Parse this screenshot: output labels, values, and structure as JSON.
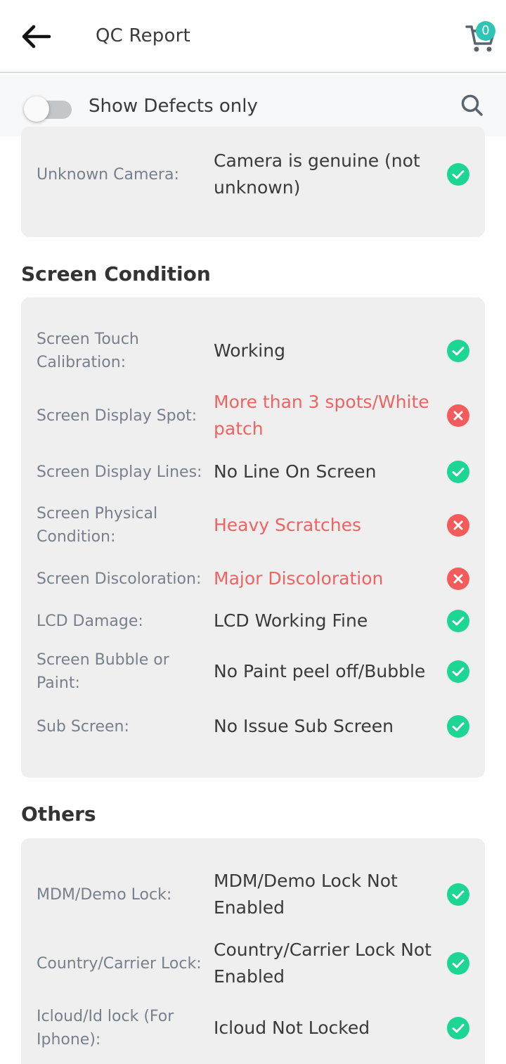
{
  "header": {
    "title": "QC Report",
    "cart_count": "0"
  },
  "filter": {
    "label": "Show Defects only",
    "toggle_on": false
  },
  "colors": {
    "ok": "#1ed694",
    "defect": "#f45c5c",
    "defect_text": "#ef6461",
    "badge": "#2ec4b6"
  },
  "camera": {
    "rows": [
      {
        "label": "Unknown Camera:",
        "value": "Camera is genuine (not unknown)",
        "status": "ok"
      }
    ]
  },
  "screen": {
    "title": "Screen Condition",
    "rows": [
      {
        "label": "Screen Touch Calibration:",
        "value": "Working",
        "status": "ok"
      },
      {
        "label": "Screen Display Spot:",
        "value": "More than 3 spots/White patch",
        "status": "defect"
      },
      {
        "label": "Screen Display Lines:",
        "value": "No Line On Screen",
        "status": "ok"
      },
      {
        "label": "Screen Physical Condition:",
        "value": "Heavy Scratches",
        "status": "defect"
      },
      {
        "label": "Screen Discoloration:",
        "value": "Major Discoloration",
        "status": "defect"
      },
      {
        "label": "LCD Damage:",
        "value": "LCD Working Fine",
        "status": "ok"
      },
      {
        "label": "Screen Bubble or Paint:",
        "value": "No Paint peel off/Bubble",
        "status": "ok"
      },
      {
        "label": "Sub Screen:",
        "value": "No Issue Sub Screen",
        "status": "ok"
      }
    ]
  },
  "others": {
    "title": "Others",
    "rows": [
      {
        "label": "MDM/Demo Lock:",
        "value": "MDM/Demo Lock Not Enabled",
        "status": "ok"
      },
      {
        "label": "Country/Carrier Lock:",
        "value": "Country/Carrier Lock Not Enabled",
        "status": "ok"
      },
      {
        "label": "Icloud/Id lock (For Iphone):",
        "value": "Icloud Not Locked",
        "status": "ok"
      }
    ]
  }
}
